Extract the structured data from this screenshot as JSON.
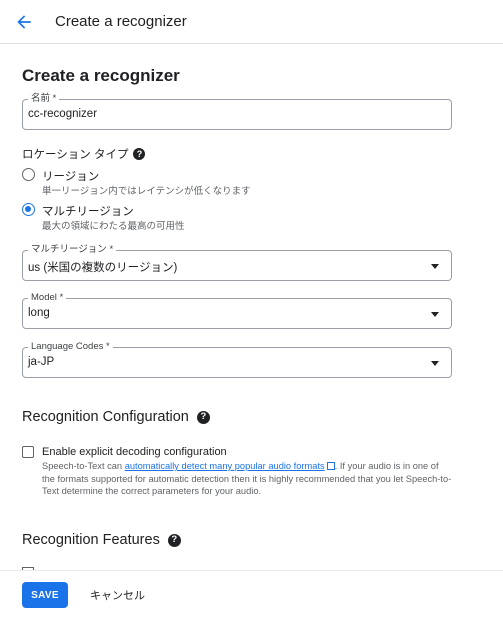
{
  "header": {
    "title": "Create a recognizer",
    "back_icon": "arrow-back-icon",
    "accent": "#1a73e8"
  },
  "form": {
    "title": "Create a recognizer",
    "name": {
      "label": "名前 *",
      "value": "cc-recognizer"
    },
    "location_type": {
      "label": "ロケーション タイプ",
      "help_icon": "help-icon",
      "options": [
        {
          "label": "リージョン",
          "description": "単一リージョン内ではレイテンシが低くなります",
          "selected": false
        },
        {
          "label": "マルチリージョン",
          "description": "最大の領域にわたる最高の可用性",
          "selected": true
        }
      ]
    },
    "multi_region": {
      "label": "マルチリージョン *",
      "value": "us (米国の複数のリージョン)"
    },
    "model": {
      "label": "Model *",
      "value": "long"
    },
    "language_codes": {
      "label": "Language Codes *",
      "value": "ja-JP"
    }
  },
  "recognition_config": {
    "title": "Recognition Configuration",
    "checkbox_label": "Enable explicit decoding configuration",
    "checked": false,
    "help_prefix": "Speech-to-Text can ",
    "help_link": "automatically detect many popular audio formats",
    "help_suffix": ". If your audio is in one of the formats supported for automatic detection then it is highly recommended that you let Speech-to-Text determine the correct parameters for your audio."
  },
  "recognition_features": {
    "title": "Recognition Features"
  },
  "footer": {
    "save_label": "SAVE",
    "cancel_label": "キャンセル"
  }
}
